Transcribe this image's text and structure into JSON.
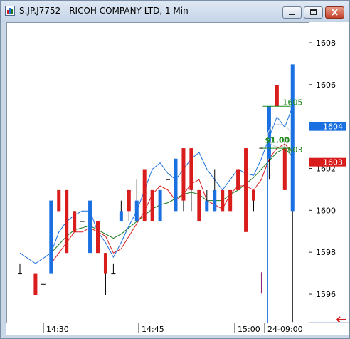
{
  "window": {
    "title": "S.JP.J7752 - RICOH COMPANY LTD, 1 Min",
    "icons": [
      "chart-app-icon",
      "minimize-icon",
      "maximize-icon",
      "close-icon"
    ]
  },
  "colors": {
    "up_bar": "#1a70e0",
    "down_bar": "#d91d1d",
    "ma_fast": "#1a70e0",
    "ma_mid": "#d91d1d",
    "ma_slow": "#1c7a1c",
    "bid_tag": "#1a70e0",
    "ask_tag": "#d91d1d",
    "order_text": "#1c8a1c"
  },
  "price_axis": {
    "labels": [
      "1608",
      "1606",
      "1604",
      "1602",
      "1600",
      "1598",
      "1596"
    ],
    "bid_tag": "1604",
    "ask_tag": "1603"
  },
  "time_axis": {
    "labels": [
      "14:30",
      "14:45",
      "15:00",
      "24-09:00"
    ]
  },
  "overlay": {
    "order_label_top": "1605",
    "order_label_mid": "$1.00",
    "order_label_low": "1603"
  },
  "chart_data": {
    "type": "candlestick",
    "ylim": [
      1594.7,
      1609.0
    ],
    "y_ticks": [
      1596,
      1598,
      1600,
      1602,
      1604,
      1606,
      1608
    ],
    "bars": [
      {
        "i": 0,
        "o": 1597.0,
        "h": 1597.5,
        "l": 1597.0,
        "c": 1597.0
      },
      {
        "i": 2,
        "o": 1597.0,
        "h": 1597.0,
        "l": 1596.0,
        "c": 1596.0
      },
      {
        "i": 3,
        "o": 1596.5,
        "h": 1596.5,
        "l": 1596.5,
        "c": 1596.5
      },
      {
        "i": 4,
        "o": 1597.0,
        "h": 1600.5,
        "l": 1597.0,
        "c": 1600.5
      },
      {
        "i": 5,
        "o": 1601.0,
        "h": 1601.0,
        "l": 1600.0,
        "c": 1600.0
      },
      {
        "i": 6,
        "o": 1601.0,
        "h": 1601.0,
        "l": 1598.0,
        "c": 1598.0
      },
      {
        "i": 7,
        "o": 1600.0,
        "h": 1600.0,
        "l": 1599.0,
        "c": 1599.0
      },
      {
        "i": 8,
        "o": 1599.5,
        "h": 1599.5,
        "l": 1599.5,
        "c": 1599.5
      },
      {
        "i": 9,
        "o": 1598.0,
        "h": 1600.5,
        "l": 1598.0,
        "c": 1600.5
      },
      {
        "i": 10,
        "o": 1599.5,
        "h": 1599.5,
        "l": 1598.0,
        "c": 1598.0
      },
      {
        "i": 11,
        "o": 1598.0,
        "h": 1598.0,
        "l": 1596.0,
        "c": 1597.0
      },
      {
        "i": 12,
        "o": 1597.0,
        "h": 1597.5,
        "l": 1597.0,
        "c": 1597.0
      },
      {
        "i": 13,
        "o": 1599.5,
        "h": 1600.5,
        "l": 1599.5,
        "c": 1600.0
      },
      {
        "i": 14,
        "o": 1601.0,
        "h": 1601.0,
        "l": 1599.5,
        "c": 1600.0
      },
      {
        "i": 15,
        "o": 1599.5,
        "h": 1601.5,
        "l": 1599.5,
        "c": 1600.5
      },
      {
        "i": 16,
        "o": 1602.0,
        "h": 1602.0,
        "l": 1599.5,
        "c": 1599.5
      },
      {
        "i": 17,
        "o": 1601.0,
        "h": 1601.0,
        "l": 1599.5,
        "c": 1599.5
      },
      {
        "i": 18,
        "o": 1599.5,
        "h": 1601.0,
        "l": 1599.5,
        "c": 1601.0
      },
      {
        "i": 19,
        "o": 1601.5,
        "h": 1601.5,
        "l": 1601.5,
        "c": 1601.5
      },
      {
        "i": 20,
        "o": 1600.0,
        "h": 1602.5,
        "l": 1600.0,
        "c": 1602.5
      },
      {
        "i": 21,
        "o": 1603.0,
        "h": 1603.0,
        "l": 1600.0,
        "c": 1600.5
      },
      {
        "i": 22,
        "o": 1603.0,
        "h": 1603.0,
        "l": 1600.0,
        "c": 1601.0
      },
      {
        "i": 23,
        "o": 1601.0,
        "h": 1601.0,
        "l": 1599.5,
        "c": 1599.5
      },
      {
        "i": 24,
        "o": 1600.0,
        "h": 1601.0,
        "l": 1600.0,
        "c": 1600.5
      },
      {
        "i": 25,
        "o": 1600.0,
        "h": 1602.0,
        "l": 1600.0,
        "c": 1601.0
      },
      {
        "i": 26,
        "o": 1601.0,
        "h": 1601.0,
        "l": 1600.0,
        "c": 1600.0
      },
      {
        "i": 27,
        "o": 1601.0,
        "h": 1601.0,
        "l": 1600.0,
        "c": 1600.0
      },
      {
        "i": 28,
        "o": 1602.0,
        "h": 1602.0,
        "l": 1601.0,
        "c": 1601.0
      },
      {
        "i": 29,
        "o": 1603.0,
        "h": 1603.0,
        "l": 1599.0,
        "c": 1599.0
      },
      {
        "i": 30,
        "o": 1601.0,
        "h": 1601.0,
        "l": 1600.0,
        "c": 1600.5
      },
      {
        "i": 31,
        "o": 1603.0,
        "h": 1603.0,
        "l": 1603.0,
        "c": 1603.0
      },
      {
        "i": 32,
        "o": 1602.5,
        "h": 1604.0,
        "l": 1601.5,
        "c": 1605.0
      },
      {
        "i": 33,
        "o": 1606.0,
        "h": 1606.0,
        "l": 1605.0,
        "c": 1605.0
      },
      {
        "i": 34,
        "o": 1603.0,
        "h": 1603.5,
        "l": 1601.0,
        "c": 1601.0
      },
      {
        "i": 35,
        "o": 1600.0,
        "h": 1607.0,
        "l": 1594.7,
        "c": 1607.0
      }
    ],
    "ma_fast": [
      [
        0,
        1598.0
      ],
      [
        2,
        1597.5
      ],
      [
        4,
        1598.0
      ],
      [
        5,
        1599.0
      ],
      [
        6,
        1599.5
      ],
      [
        7,
        1599.8
      ],
      [
        8,
        1600.0
      ],
      [
        9,
        1600.0
      ],
      [
        10,
        1599.0
      ],
      [
        11,
        1598.5
      ],
      [
        12,
        1597.8
      ],
      [
        13,
        1598.5
      ],
      [
        14,
        1599.3
      ],
      [
        15,
        1600.0
      ],
      [
        16,
        1601.0
      ],
      [
        17,
        1602.0
      ],
      [
        18,
        1602.3
      ],
      [
        19,
        1601.8
      ],
      [
        20,
        1601.5
      ],
      [
        21,
        1602.0
      ],
      [
        22,
        1602.5
      ],
      [
        23,
        1602.8
      ],
      [
        24,
        1602.0
      ],
      [
        25,
        1601.5
      ],
      [
        26,
        1601.0
      ],
      [
        27,
        1601.5
      ],
      [
        28,
        1602.0
      ],
      [
        29,
        1601.8
      ],
      [
        30,
        1601.7
      ],
      [
        31,
        1602.5
      ],
      [
        32,
        1603.5
      ],
      [
        33,
        1604.5
      ],
      [
        34,
        1604.0
      ],
      [
        35,
        1605.0
      ]
    ],
    "ma_mid": [
      [
        4,
        1597.5
      ],
      [
        5,
        1598.0
      ],
      [
        6,
        1598.5
      ],
      [
        7,
        1599.0
      ],
      [
        8,
        1599.0
      ],
      [
        9,
        1599.2
      ],
      [
        10,
        1599.0
      ],
      [
        11,
        1598.8
      ],
      [
        12,
        1598.0
      ],
      [
        13,
        1598.2
      ],
      [
        14,
        1598.8
      ],
      [
        15,
        1599.4
      ],
      [
        16,
        1600.0
      ],
      [
        17,
        1600.8
      ],
      [
        18,
        1601.2
      ],
      [
        19,
        1601.0
      ],
      [
        20,
        1600.5
      ],
      [
        21,
        1600.8
      ],
      [
        22,
        1601.3
      ],
      [
        23,
        1601.5
      ],
      [
        24,
        1600.5
      ],
      [
        25,
        1600.3
      ],
      [
        26,
        1600.1
      ],
      [
        27,
        1600.8
      ],
      [
        28,
        1601.2
      ],
      [
        29,
        1601.2
      ],
      [
        30,
        1601.0
      ],
      [
        31,
        1601.5
      ],
      [
        32,
        1602.5
      ],
      [
        33,
        1603.0
      ],
      [
        34,
        1603.2
      ],
      [
        35,
        1602.8
      ]
    ],
    "ma_slow": [
      [
        4,
        1598.0
      ],
      [
        5,
        1598.4
      ],
      [
        6,
        1598.8
      ],
      [
        7,
        1599.1
      ],
      [
        8,
        1599.2
      ],
      [
        9,
        1599.3
      ],
      [
        10,
        1599.1
      ],
      [
        11,
        1598.9
      ],
      [
        12,
        1598.7
      ],
      [
        13,
        1598.9
      ],
      [
        14,
        1599.2
      ],
      [
        15,
        1599.5
      ],
      [
        16,
        1599.8
      ],
      [
        17,
        1600.1
      ],
      [
        18,
        1600.3
      ],
      [
        19,
        1600.4
      ],
      [
        20,
        1600.6
      ],
      [
        21,
        1600.8
      ],
      [
        22,
        1600.9
      ],
      [
        23,
        1600.8
      ],
      [
        24,
        1600.5
      ],
      [
        25,
        1600.5
      ],
      [
        26,
        1600.5
      ],
      [
        27,
        1600.8
      ],
      [
        28,
        1601.0
      ],
      [
        29,
        1601.3
      ],
      [
        30,
        1601.6
      ],
      [
        31,
        1602.0
      ],
      [
        32,
        1602.4
      ],
      [
        33,
        1602.8
      ],
      [
        34,
        1603.0
      ],
      [
        35,
        1602.6
      ]
    ]
  }
}
